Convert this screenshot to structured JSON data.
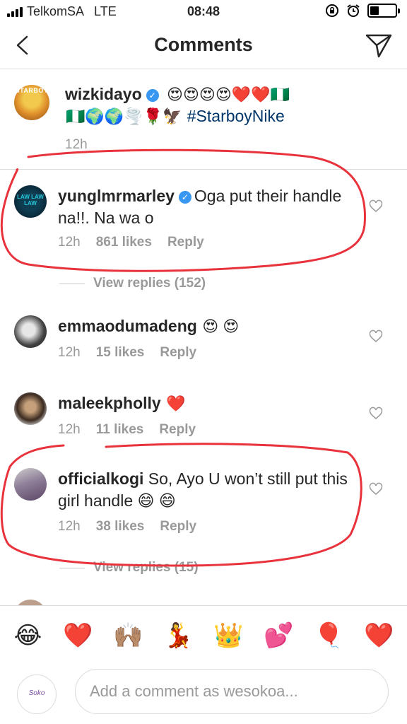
{
  "status_bar": {
    "carrier": "TelkomSA",
    "network": "LTE",
    "time": "08:48",
    "battery_level": 0.35
  },
  "header": {
    "title": "Comments",
    "back_icon": "chevron-left-icon",
    "send_icon": "paper-plane-icon"
  },
  "caption": {
    "username": "wizkidayo",
    "avatar_text": "STARBOY",
    "emojis_line1": "😍😍😍😍❤️❤️🇳🇬",
    "emojis_line2": "🇳🇬🌍🌍🌪️🌹🦅",
    "hashtag": "#StarboyNike",
    "time": "12h"
  },
  "comments": [
    {
      "username": "yunglmrmarley",
      "avatar_text": "LAW LAW LAW",
      "text": "Oga put their handle na!!. Na wa o",
      "time": "12h",
      "likes": "861 likes",
      "reply": "Reply",
      "view_replies": "View replies (152)"
    },
    {
      "username": "emmaodumadeng",
      "text": "😍 😍",
      "time": "12h",
      "likes": "15 likes",
      "reply": "Reply"
    },
    {
      "username": "maleekpholly",
      "text": "❤️",
      "time": "12h",
      "likes": "11 likes",
      "reply": "Reply"
    },
    {
      "username": "officialkogi",
      "text": "So, Ayo U won’t still put this girl handle 😄 😄",
      "time": "12h",
      "likes": "38 likes",
      "reply": "Reply",
      "view_replies": "View replies (15)"
    }
  ],
  "emoji_bar": [
    "😂",
    "❤️",
    "🙌🏽",
    "💃",
    "👑",
    "💕",
    "🎈",
    "❤️"
  ],
  "composer": {
    "avatar_text": "Soko",
    "placeholder": "Add a comment as wesokoa..."
  },
  "colors": {
    "annotation_red": "#e8333d",
    "verified_blue": "#3897f0",
    "hashtag": "#003569",
    "muted": "#999999"
  }
}
